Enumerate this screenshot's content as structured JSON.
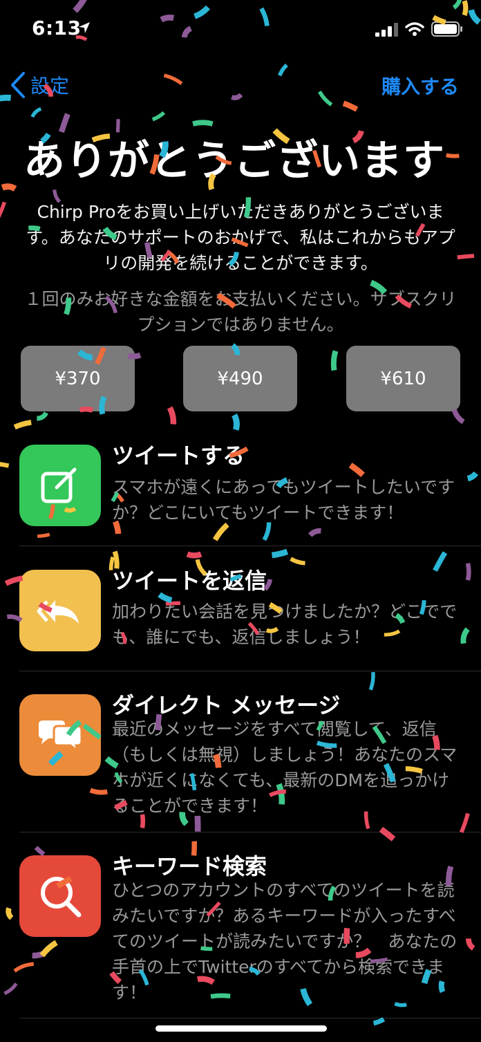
{
  "status_bar": {
    "time": "6:13"
  },
  "nav": {
    "back_label": "設定",
    "buy_label": "購入する"
  },
  "header": {
    "title": "ありがとうございます",
    "intro": "Chirp Proをお買い上げいただきありがとうございます。あなたのサポートのおかげで、私はこれからもアプリの開発を続けることができます。",
    "note": "１回のみお好きな金額をお支払いください。サブスクリプションではありません。"
  },
  "prices": [
    "¥370",
    "¥490",
    "¥610"
  ],
  "features": [
    {
      "title": "ツイートする",
      "desc": "スマホが遠くにあってもツイートしたいですか？どこにいてもツイートできます！",
      "icon": "compose-icon",
      "color": "#34c759"
    },
    {
      "title": "ツイートを返信",
      "desc": "加わりたい会話を見つけましたか？どこででも、誰にでも、返信しましょう！",
      "icon": "reply-all-icon",
      "color": "#f2c04f"
    },
    {
      "title": "ダイレクト メッセージ",
      "desc": "最近のメッセージをすべて閲覧して、返信（もしくは無視）しましょう！あなたのスマホが近くになくても、最新のDMを追っかけることができます！",
      "icon": "chat-bubbles-icon",
      "color": "#ec8c3a"
    },
    {
      "title": "キーワード検索",
      "desc": "ひとつのアカウントのすべてのツイートを読みたいですか？あるキーワードが入ったすべてのツイートが読みたいですか？　あなたの手首の上でTwitterのすべてから検索できます！",
      "icon": "magnifier-icon",
      "color": "#e5493a"
    }
  ],
  "colors": {
    "accent": "#1e88f5",
    "background": "#000000",
    "price_button": "#7b7b7b",
    "secondary_text": "#9a9a9a"
  }
}
